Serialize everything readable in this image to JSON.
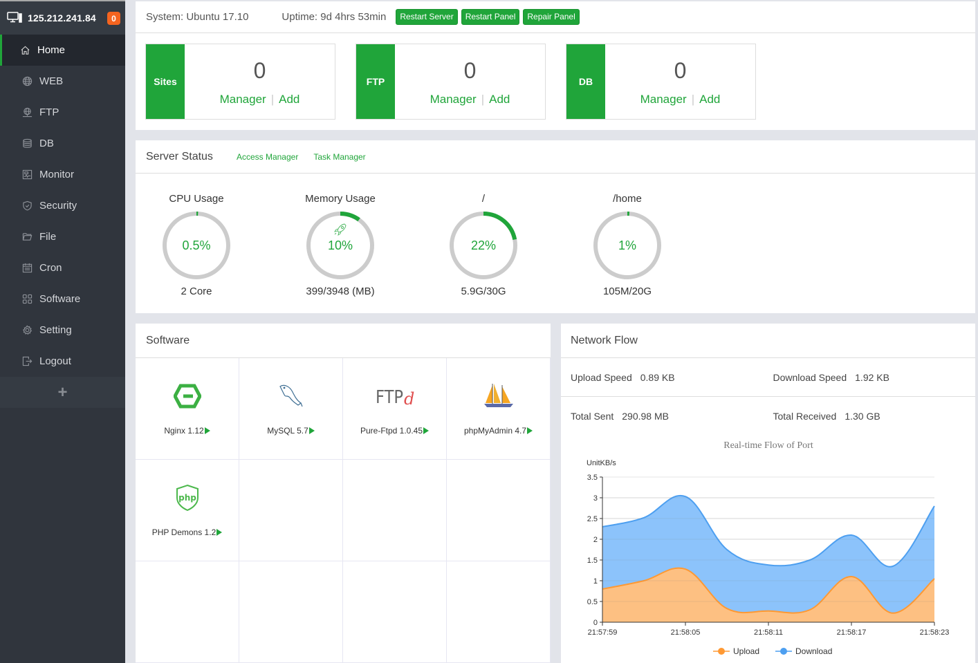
{
  "sidebar": {
    "server_ip": "125.212.241.84",
    "badge_count": "0",
    "items": [
      {
        "label": "Home",
        "icon": "home-icon",
        "active": true
      },
      {
        "label": "WEB",
        "icon": "globe-icon"
      },
      {
        "label": "FTP",
        "icon": "ftp-globe-icon"
      },
      {
        "label": "DB",
        "icon": "database-icon"
      },
      {
        "label": "Monitor",
        "icon": "monitor-chart-icon"
      },
      {
        "label": "Security",
        "icon": "shield-icon"
      },
      {
        "label": "File",
        "icon": "folder-icon"
      },
      {
        "label": "Cron",
        "icon": "calendar-icon"
      },
      {
        "label": "Software",
        "icon": "grid-apps-icon"
      },
      {
        "label": "Setting",
        "icon": "gear-icon"
      },
      {
        "label": "Logout",
        "icon": "logout-icon"
      }
    ],
    "add_label": "+"
  },
  "topbar": {
    "system": "System: Ubuntu 17.10",
    "uptime": "Uptime: 9d 4hrs 53min",
    "buttons": [
      "Restart Server",
      "Restart Panel",
      "Repair Panel"
    ]
  },
  "overview": [
    {
      "tag": "Sites",
      "count": "0",
      "manager": "Manager",
      "add": "Add"
    },
    {
      "tag": "FTP",
      "count": "0",
      "manager": "Manager",
      "add": "Add"
    },
    {
      "tag": "DB",
      "count": "0",
      "manager": "Manager",
      "add": "Add"
    }
  ],
  "status": {
    "title": "Server Status",
    "links": [
      "Access Manager",
      "Task Manager"
    ],
    "gauges": [
      {
        "title": "CPU Usage",
        "value": "0.5%",
        "percent": 0.5,
        "sub": "2 Core"
      },
      {
        "title": "Memory Usage",
        "value": "10%",
        "percent": 10,
        "sub": "399/3948 (MB)",
        "icon": "rocket-icon"
      },
      {
        "title": "/",
        "value": "22%",
        "percent": 22,
        "sub": "5.9G/30G"
      },
      {
        "title": "/home",
        "value": "1%",
        "percent": 1,
        "sub": "105M/20G"
      }
    ],
    "colors": {
      "accent": "#20a53a",
      "track": "#cccccc"
    }
  },
  "software": {
    "title": "Software",
    "items": [
      {
        "name": "Nginx 1.12",
        "icon": "nginx-logo-icon"
      },
      {
        "name": "MySQL 5.7",
        "icon": "mysql-dolphin-icon"
      },
      {
        "name": "Pure-Ftpd 1.0.45",
        "icon": "ftpd-logo-icon"
      },
      {
        "name": "phpMyAdmin 4.7",
        "icon": "phpmyadmin-sailboat-icon"
      },
      {
        "name": "PHP Demons 1.2",
        "icon": "php-shield-icon"
      }
    ]
  },
  "network": {
    "title": "Network Flow",
    "upload_speed_label": "Upload Speed",
    "upload_speed": "0.89 KB",
    "download_speed_label": "Download Speed",
    "download_speed": "1.92 KB",
    "total_sent_label": "Total Sent",
    "total_sent": "290.98 MB",
    "total_received_label": "Total Received",
    "total_received": "1.30 GB"
  },
  "chart_data": {
    "type": "area",
    "stacked": true,
    "title": "Real-time Flow of Port",
    "ylabel": "UnitKB/s",
    "xlabel": "",
    "ylim": [
      0,
      3.5
    ],
    "yticks": [
      "0",
      "0.5",
      "1",
      "1.5",
      "2",
      "2.5",
      "3",
      "3.5"
    ],
    "x": [
      "21:57:59",
      "21:58:02",
      "21:58:05",
      "21:58:08",
      "21:58:11",
      "21:58:14",
      "21:58:17",
      "21:58:20",
      "21:58:23"
    ],
    "xticks": [
      "21:57:59",
      "21:58:05",
      "21:58:11",
      "21:58:17",
      "21:58:23"
    ],
    "grid": true,
    "legend": "bottom",
    "series": [
      {
        "name": "Upload",
        "color": "#ff9933",
        "values": [
          0.8,
          1.0,
          1.28,
          0.33,
          0.27,
          0.3,
          1.1,
          0.22,
          1.05
        ]
      },
      {
        "name": "Download",
        "color": "#4d9ff0",
        "values": [
          1.5,
          1.52,
          1.75,
          1.42,
          1.11,
          1.2,
          1.0,
          1.13,
          1.75
        ]
      }
    ]
  }
}
